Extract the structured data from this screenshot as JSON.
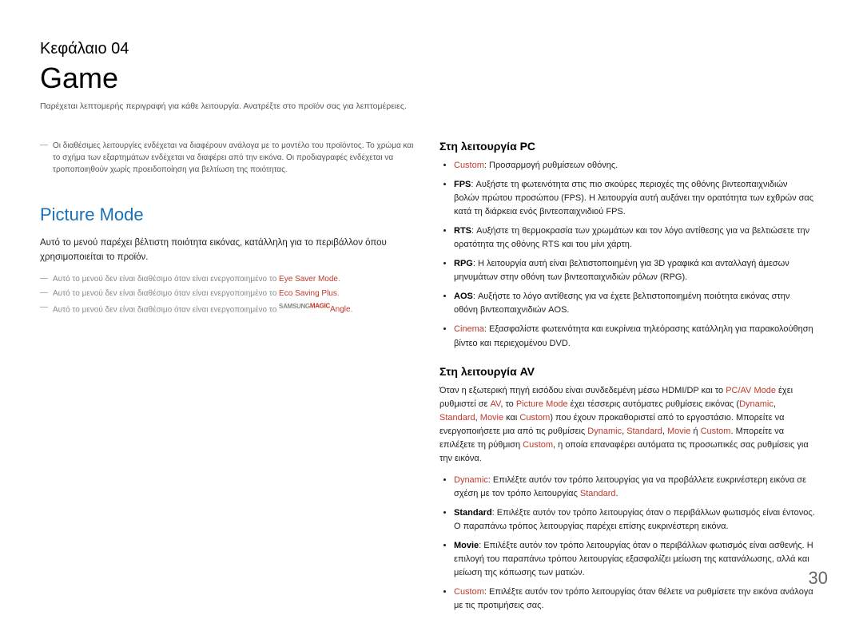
{
  "chapter_label": "Κεφάλαιο 04",
  "page_title": "Game",
  "page_intro": "Παρέχεται λεπτομερής περιγραφή για κάθε λειτουργία. Ανατρέξτε στο προϊόν σας για λεπτομέρειες.",
  "left": {
    "top_note": "Οι διαθέσιμες λειτουργίες ενδέχεται να διαφέρουν ανάλογα με το μοντέλο του προϊόντος. Το χρώμα και το σχήμα των εξαρτημάτων ενδέχεται να διαφέρει από την εικόνα. Οι προδιαγραφές ενδέχεται να τροποποιηθούν χωρίς προειδοποίηση για βελτίωση της ποιότητας.",
    "section_heading": "Picture Mode",
    "section_body": "Αυτό το μενού παρέχει βέλτιστη ποιότητα εικόνας, κατάλληλη για το περιβάλλον όπου χρησιμοποιείται το προϊόν.",
    "notes": {
      "a_prefix": "Αυτό το μενού δεν είναι διαθέσιμο όταν είναι ενεργοποιημένο το ",
      "a_kw": "Eye Saver Mode",
      "b_prefix": "Αυτό το μενού δεν είναι διαθέσιμο όταν είναι ενεργοποιημένο το ",
      "b_kw": "Eco Saving Plus",
      "c_prefix": "Αυτό το μενού δεν είναι διαθέσιμο όταν είναι ενεργοποιημένο το ",
      "c_brand1": "SAMSUNG",
      "c_brand2": "MAGIC",
      "c_kw": "Angle"
    }
  },
  "right": {
    "pc_heading": "Στη λειτουργία PC",
    "pc": {
      "custom": {
        "kw": "Custom",
        "text": ": Προσαρμογή ρυθμίσεων οθόνης."
      },
      "fps": {
        "kw": "FPS",
        "text": ": Αυξήστε τη φωτεινότητα στις πιο σκούρες περιοχές της οθόνης βιντεοπαιχνιδιών βολών πρώτου προσώπου (FPS). Η λειτουργία αυτή αυξάνει την ορατότητα των εχθρών σας κατά τη διάρκεια ενός βιντεοπαιχνιδιού FPS."
      },
      "rts": {
        "kw": "RTS",
        "text": ": Αυξήστε τη θερμοκρασία των χρωμάτων και τον λόγο αντίθεσης για να βελτιώσετε την ορατότητα της οθόνης RTS και του μίνι χάρτη."
      },
      "rpg": {
        "kw": "RPG",
        "text": ": Η λειτουργία αυτή είναι βελτιστοποιημένη για 3D γραφικά και ανταλλαγή άμεσων μηνυμάτων στην οθόνη των βιντεοπαιχνιδιών ρόλων (RPG)."
      },
      "aos": {
        "kw": "AOS",
        "text": ": Αυξήστε το λόγο αντίθεσης για να έχετε βελτιστοποιημένη ποιότητα εικόνας στην οθόνη βιντεοπαιχνιδιών AOS."
      },
      "cinema": {
        "kw": "Cinema",
        "text": ": Εξασφαλίστε φωτεινότητα και ευκρίνεια τηλεόρασης κατάλληλη για παρακολούθηση βίντεο και περιεχομένου DVD."
      }
    },
    "av_heading": "Στη λειτουργία AV",
    "av_intro": {
      "t1": "Όταν η εξωτερική πηγή εισόδου είναι συνδεδεμένη μέσω HDMI/DP και το ",
      "kw1": "PC/AV Mode",
      "t2": " έχει ρυθμιστεί σε ",
      "kw2": "AV",
      "t3": ", το ",
      "kw3": "Picture Mode",
      "t4": " έχει τέσσερις αυτόματες ρυθμίσεις εικόνας (",
      "kw4": "Dynamic",
      "kw5": "Standard",
      "kw6": "Movie",
      "t_and": " και ",
      "kw7": "Custom",
      "t5": ") που έχουν προκαθοριστεί από το εργοστάσιο. Μπορείτε να ενεργοποιήσετε μια από τις ρυθμίσεις ",
      "kw8": "Dynamic",
      "kw9": "Standard",
      "kw10": "Movie",
      "t_or": " ή ",
      "kw11": "Custom",
      "t6": ". Μπορείτε να επιλέξετε τη ρύθμιση ",
      "kw12": "Custom",
      "t7": ", η οποία επαναφέρει αυτόματα τις προσωπικές σας ρυθμίσεις για την εικόνα."
    },
    "av": {
      "dynamic": {
        "kw": "Dynamic",
        "t1": ": Επιλέξτε αυτόν τον τρόπο λειτουργίας για να προβάλλετε ευκρινέστερη εικόνα σε σχέση με τον τρόπο λειτουργίας ",
        "kw2": "Standard",
        "t2": "."
      },
      "standard": {
        "kw": "Standard",
        "text": ": Επιλέξτε αυτόν τον τρόπο λειτουργίας όταν ο περιβάλλων φωτισμός είναι έντονος. Ο παραπάνω τρόπος λειτουργίας παρέχει επίσης ευκρινέστερη εικόνα."
      },
      "movie": {
        "kw": "Movie",
        "text": ": Επιλέξτε αυτόν τον τρόπο λειτουργίας όταν ο περιβάλλων φωτισμός είναι ασθενής. Η επιλογή του παραπάνω τρόπου λειτουργίας εξασφαλίζει μείωση της κατανάλωσης, αλλά και μείωση της κόπωσης των ματιών."
      },
      "custom": {
        "kw": "Custom",
        "text": ": Επιλέξτε αυτόν τον τρόπο λειτουργίας όταν θέλετε να ρυθμίσετε την εικόνα ανάλογα με τις προτιμήσεις σας."
      }
    }
  },
  "page_number": "30"
}
